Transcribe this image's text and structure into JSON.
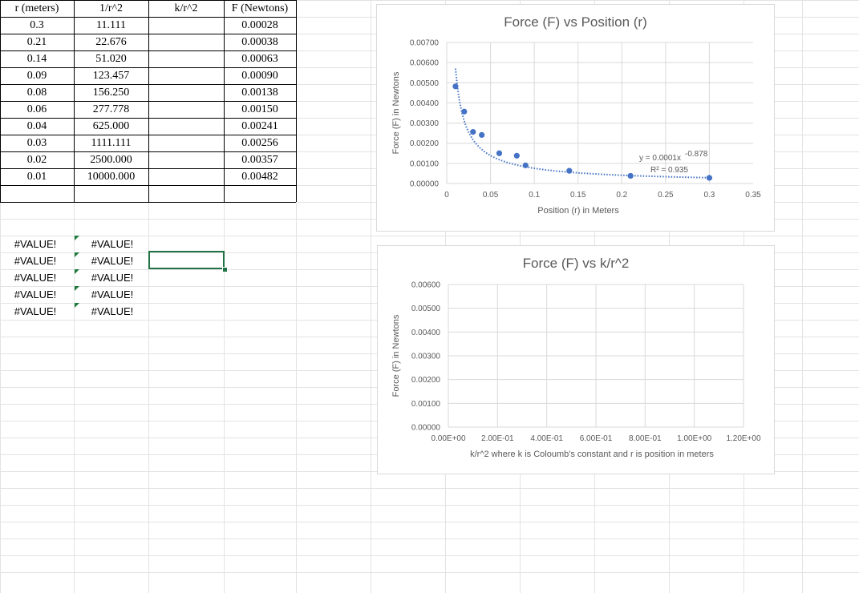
{
  "spreadsheet": {
    "headers": [
      "r (meters)",
      "1/r^2",
      "k/r^2",
      "F (Newtons)"
    ],
    "rows": [
      [
        "0.3",
        "11.111",
        "",
        "0.00028"
      ],
      [
        "0.21",
        "22.676",
        "",
        "0.00038"
      ],
      [
        "0.14",
        "51.020",
        "",
        "0.00063"
      ],
      [
        "0.09",
        "123.457",
        "",
        "0.00090"
      ],
      [
        "0.08",
        "156.250",
        "",
        "0.00138"
      ],
      [
        "0.06",
        "277.778",
        "",
        "0.00150"
      ],
      [
        "0.04",
        "625.000",
        "",
        "0.00241"
      ],
      [
        "0.03",
        "1111.111",
        "",
        "0.00256"
      ],
      [
        "0.02",
        "2500.000",
        "",
        "0.00357"
      ],
      [
        "0.01",
        "10000.000",
        "",
        "0.00482"
      ]
    ],
    "error_rows": [
      [
        "#VALUE!",
        "#VALUE!"
      ],
      [
        "#VALUE!",
        "#VALUE!"
      ],
      [
        "#VALUE!",
        "#VALUE!"
      ],
      [
        "#VALUE!",
        "#VALUE!"
      ],
      [
        "#VALUE!",
        "#VALUE!"
      ]
    ]
  },
  "colors": {
    "marker": "#4472c4",
    "grid": "#d9d9d9",
    "selection": "#217346",
    "text": "#595959"
  },
  "chart_data": [
    {
      "type": "scatter",
      "title": "Force (F) vs Position (r)",
      "xlabel": "Position (r) in Meters",
      "ylabel": "Force (F) in Newtons",
      "xlim": [
        0,
        0.35
      ],
      "ylim": [
        0,
        0.007
      ],
      "x_ticks": [
        "0",
        "0.05",
        "0.1",
        "0.15",
        "0.2",
        "0.25",
        "0.3",
        "0.35"
      ],
      "y_ticks": [
        "0.00000",
        "0.00100",
        "0.00200",
        "0.00300",
        "0.00400",
        "0.00500",
        "0.00600",
        "0.00700"
      ],
      "grid": true,
      "points": [
        {
          "x": 0.3,
          "y": 0.00028
        },
        {
          "x": 0.21,
          "y": 0.00038
        },
        {
          "x": 0.14,
          "y": 0.00063
        },
        {
          "x": 0.09,
          "y": 0.0009
        },
        {
          "x": 0.08,
          "y": 0.00138
        },
        {
          "x": 0.06,
          "y": 0.0015
        },
        {
          "x": 0.04,
          "y": 0.00241
        },
        {
          "x": 0.03,
          "y": 0.00256
        },
        {
          "x": 0.02,
          "y": 0.00357
        },
        {
          "x": 0.01,
          "y": 0.00482
        }
      ],
      "trendline": {
        "type": "power",
        "a": 0.0001,
        "b": -0.878,
        "x_range": [
          0.01,
          0.3
        ]
      },
      "trendline_labels": [
        "y = 0.0001x",
        "-0.878",
        "R² = 0.935"
      ]
    },
    {
      "type": "scatter",
      "title": "Force (F) vs k/r^2",
      "xlabel": "k/r^2 where k is Coloumb's constant and r is position in meters",
      "ylabel": "Force (F) in Newtons",
      "xlim": [
        0,
        1.2
      ],
      "ylim": [
        0,
        0.006
      ],
      "x_ticks": [
        "0.00E+00",
        "2.00E-01",
        "4.00E-01",
        "6.00E-01",
        "8.00E-01",
        "1.00E+00",
        "1.20E+00"
      ],
      "y_ticks": [
        "0.00000",
        "0.00100",
        "0.00200",
        "0.00300",
        "0.00400",
        "0.00500",
        "0.00600"
      ],
      "grid": true,
      "points": []
    }
  ]
}
